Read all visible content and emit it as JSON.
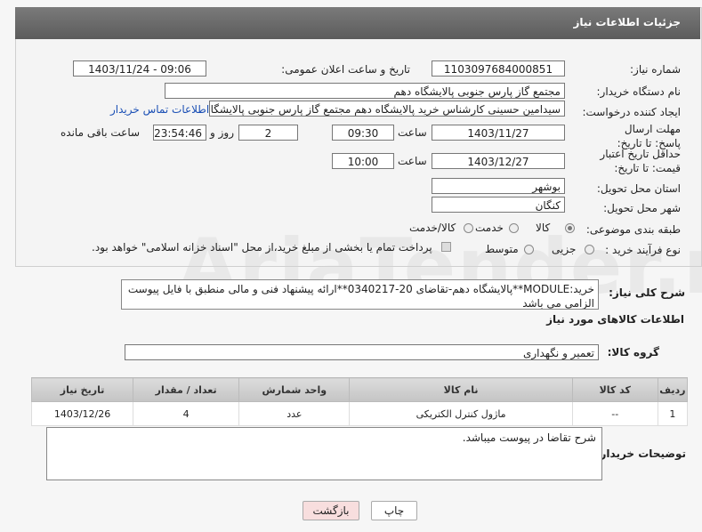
{
  "header": {
    "title": "جزئیات اطلاعات نیاز"
  },
  "fields": {
    "need_number_label": "شماره نیاز:",
    "need_number": "1103097684000851",
    "announce_label": "تاریخ و ساعت اعلان عمومی:",
    "announce_value": "1403/11/24 - 09:06",
    "buyer_org_label": "نام دستگاه خریدار:",
    "buyer_org": "مجتمع گاز پارس جنوبی  پالایشگاه دهم",
    "creator_label": "ایجاد کننده درخواست:",
    "creator": "سیدامین حسینی کارشناس خرید پالایشگاه دهم  مجتمع گاز پارس جنوبی  پالایشگاه دهم",
    "contact_link": "اطلاعات تماس خریدار",
    "deadline_label": "مهلت ارسال پاسخ: تا تاریخ:",
    "deadline_date": "1403/11/27",
    "time_label": "ساعت",
    "deadline_time": "09:30",
    "days_value": "2",
    "day_and": "روز و",
    "remaining_time": "23:54:46",
    "remaining_label": "ساعت باقی مانده",
    "validity_label": "حداقل تاریخ اعتبار قیمت: تا تاریخ:",
    "validity_date": "1403/12/27",
    "validity_time": "10:00",
    "province_label": "استان محل تحویل:",
    "province": "بوشهر",
    "city_label": "شهر محل تحویل:",
    "city": "کنگان",
    "category_label": "طبقه بندی موضوعی:",
    "category_options": [
      "کالا",
      "خدمت",
      "کالا/خدمت"
    ],
    "process_label": "نوع فرآیند خرید :",
    "process_options": [
      "جزیی",
      "متوسط"
    ],
    "payment_note": "پرداخت تمام یا بخشی از مبلغ خرید،از محل \"اسناد خزانه اسلامی\" خواهد بود."
  },
  "description": {
    "label": "شرح کلی نیاز:",
    "text": "خرید:MODULE**پالایشگاه دهم-تقاضای 20-0340217**ارائه پیشنهاد فنی و مالی منطبق با فایل پیوست الزامی می باشد"
  },
  "goods": {
    "section_title": "اطلاعات کالاهای مورد نیاز",
    "group_label": "گروه کالا:",
    "group_value": "تعمیر و نگهداری",
    "columns": [
      "ردیف",
      "کد کالا",
      "نام کالا",
      "واحد شمارش",
      "تعداد / مقدار",
      "تاریخ نیاز"
    ],
    "rows": [
      {
        "row": "1",
        "code": "--",
        "name": "ماژول کنترل الکتریکی",
        "unit": "عدد",
        "qty": "4",
        "date": "1403/12/26"
      }
    ]
  },
  "buyer_notes": {
    "label": "توضیحات خریدار:",
    "text": "شرح تقاضا در پیوست میباشد."
  },
  "buttons": {
    "print": "چاپ",
    "back": "بازگشت"
  },
  "colors": {
    "header_bg": "#6b6b6b",
    "link": "#1a4fb5",
    "back_btn_bg": "#f8dede"
  }
}
